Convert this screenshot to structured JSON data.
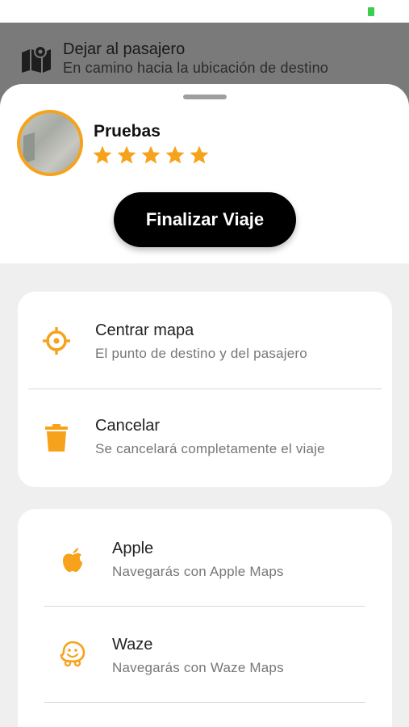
{
  "topbar": {
    "title": "Dejar al pasajero",
    "subtitle": "En camino hacia la ubicación de destino"
  },
  "profile": {
    "name": "Pruebas",
    "rating": 5
  },
  "actions": {
    "finish_label": "Finalizar Viaje"
  },
  "options": [
    {
      "title": "Centrar mapa",
      "subtitle": "El punto de destino y del pasajero",
      "icon": "crosshair-icon"
    },
    {
      "title": "Cancelar",
      "subtitle": "Se cancelará completamente el viaje",
      "icon": "trash-icon"
    }
  ],
  "navigation": [
    {
      "title": "Apple",
      "subtitle": "Navegarás con Apple Maps",
      "icon": "apple-icon"
    },
    {
      "title": "Waze",
      "subtitle": "Navegarás con Waze Maps",
      "icon": "waze-icon"
    }
  ],
  "colors": {
    "accent": "#f7a21b",
    "button": "#000000"
  }
}
